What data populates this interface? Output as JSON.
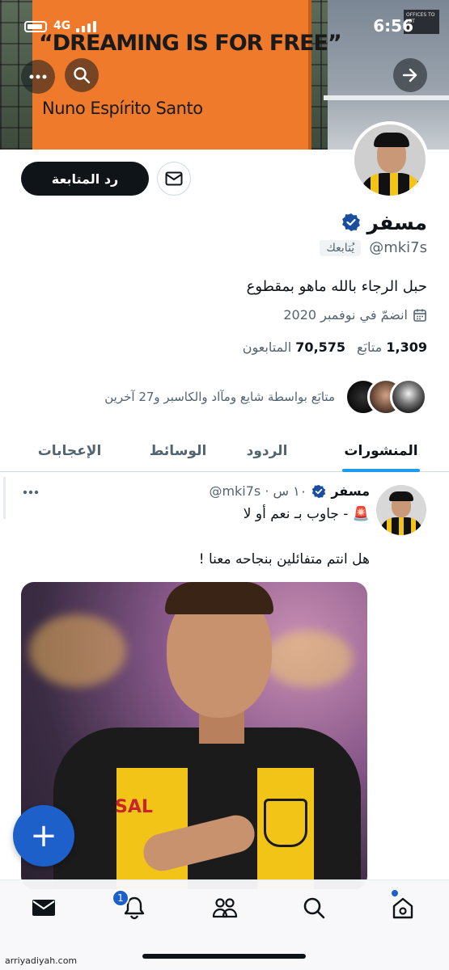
{
  "status_bar": {
    "network": "4G",
    "time": "6:56"
  },
  "banner": {
    "slogan": "“DREAMING IS FOR FREE”",
    "signature": "Nuno Espírito Santo",
    "sign_text": "OFFICES TO LET"
  },
  "profile": {
    "follow_button": "رد المتابعة",
    "name": "مسفر",
    "handle": "@mki7s",
    "follows_you": "يُتابعك",
    "bio": "حبل الرجاء بالله ماهو بمقطوع",
    "joined": "انضمّ في نوفمبر 2020",
    "following_count": "1,309",
    "following_label": "متابَع",
    "followers_count": "70,575",
    "followers_label": "المتابعون",
    "followed_by": "متابَع بواسطة شايع ومآاد والكاسبر و27 آخرين"
  },
  "tabs": [
    {
      "label": "المنشورات",
      "active": true
    },
    {
      "label": "الردود",
      "active": false
    },
    {
      "label": "الوسائط",
      "active": false
    },
    {
      "label": "الإعجابات",
      "active": false
    }
  ],
  "post": {
    "name": "مسفر",
    "meta": "@mki7s · ١٠ س",
    "line1": "🚨 - جاوب بـ نعم أو لا",
    "line2": "هل انتم متفائلين بنجاحه معنا !",
    "media_sponsor": "SAL"
  },
  "fab": {
    "label": "+"
  },
  "nav": {
    "notifications_badge": "1"
  },
  "watermark": "arriyadiyah.com",
  "colors": {
    "accent": "#1d9bf0",
    "fab": "#1d60c9",
    "text": "#0f1419",
    "muted": "#536471"
  }
}
